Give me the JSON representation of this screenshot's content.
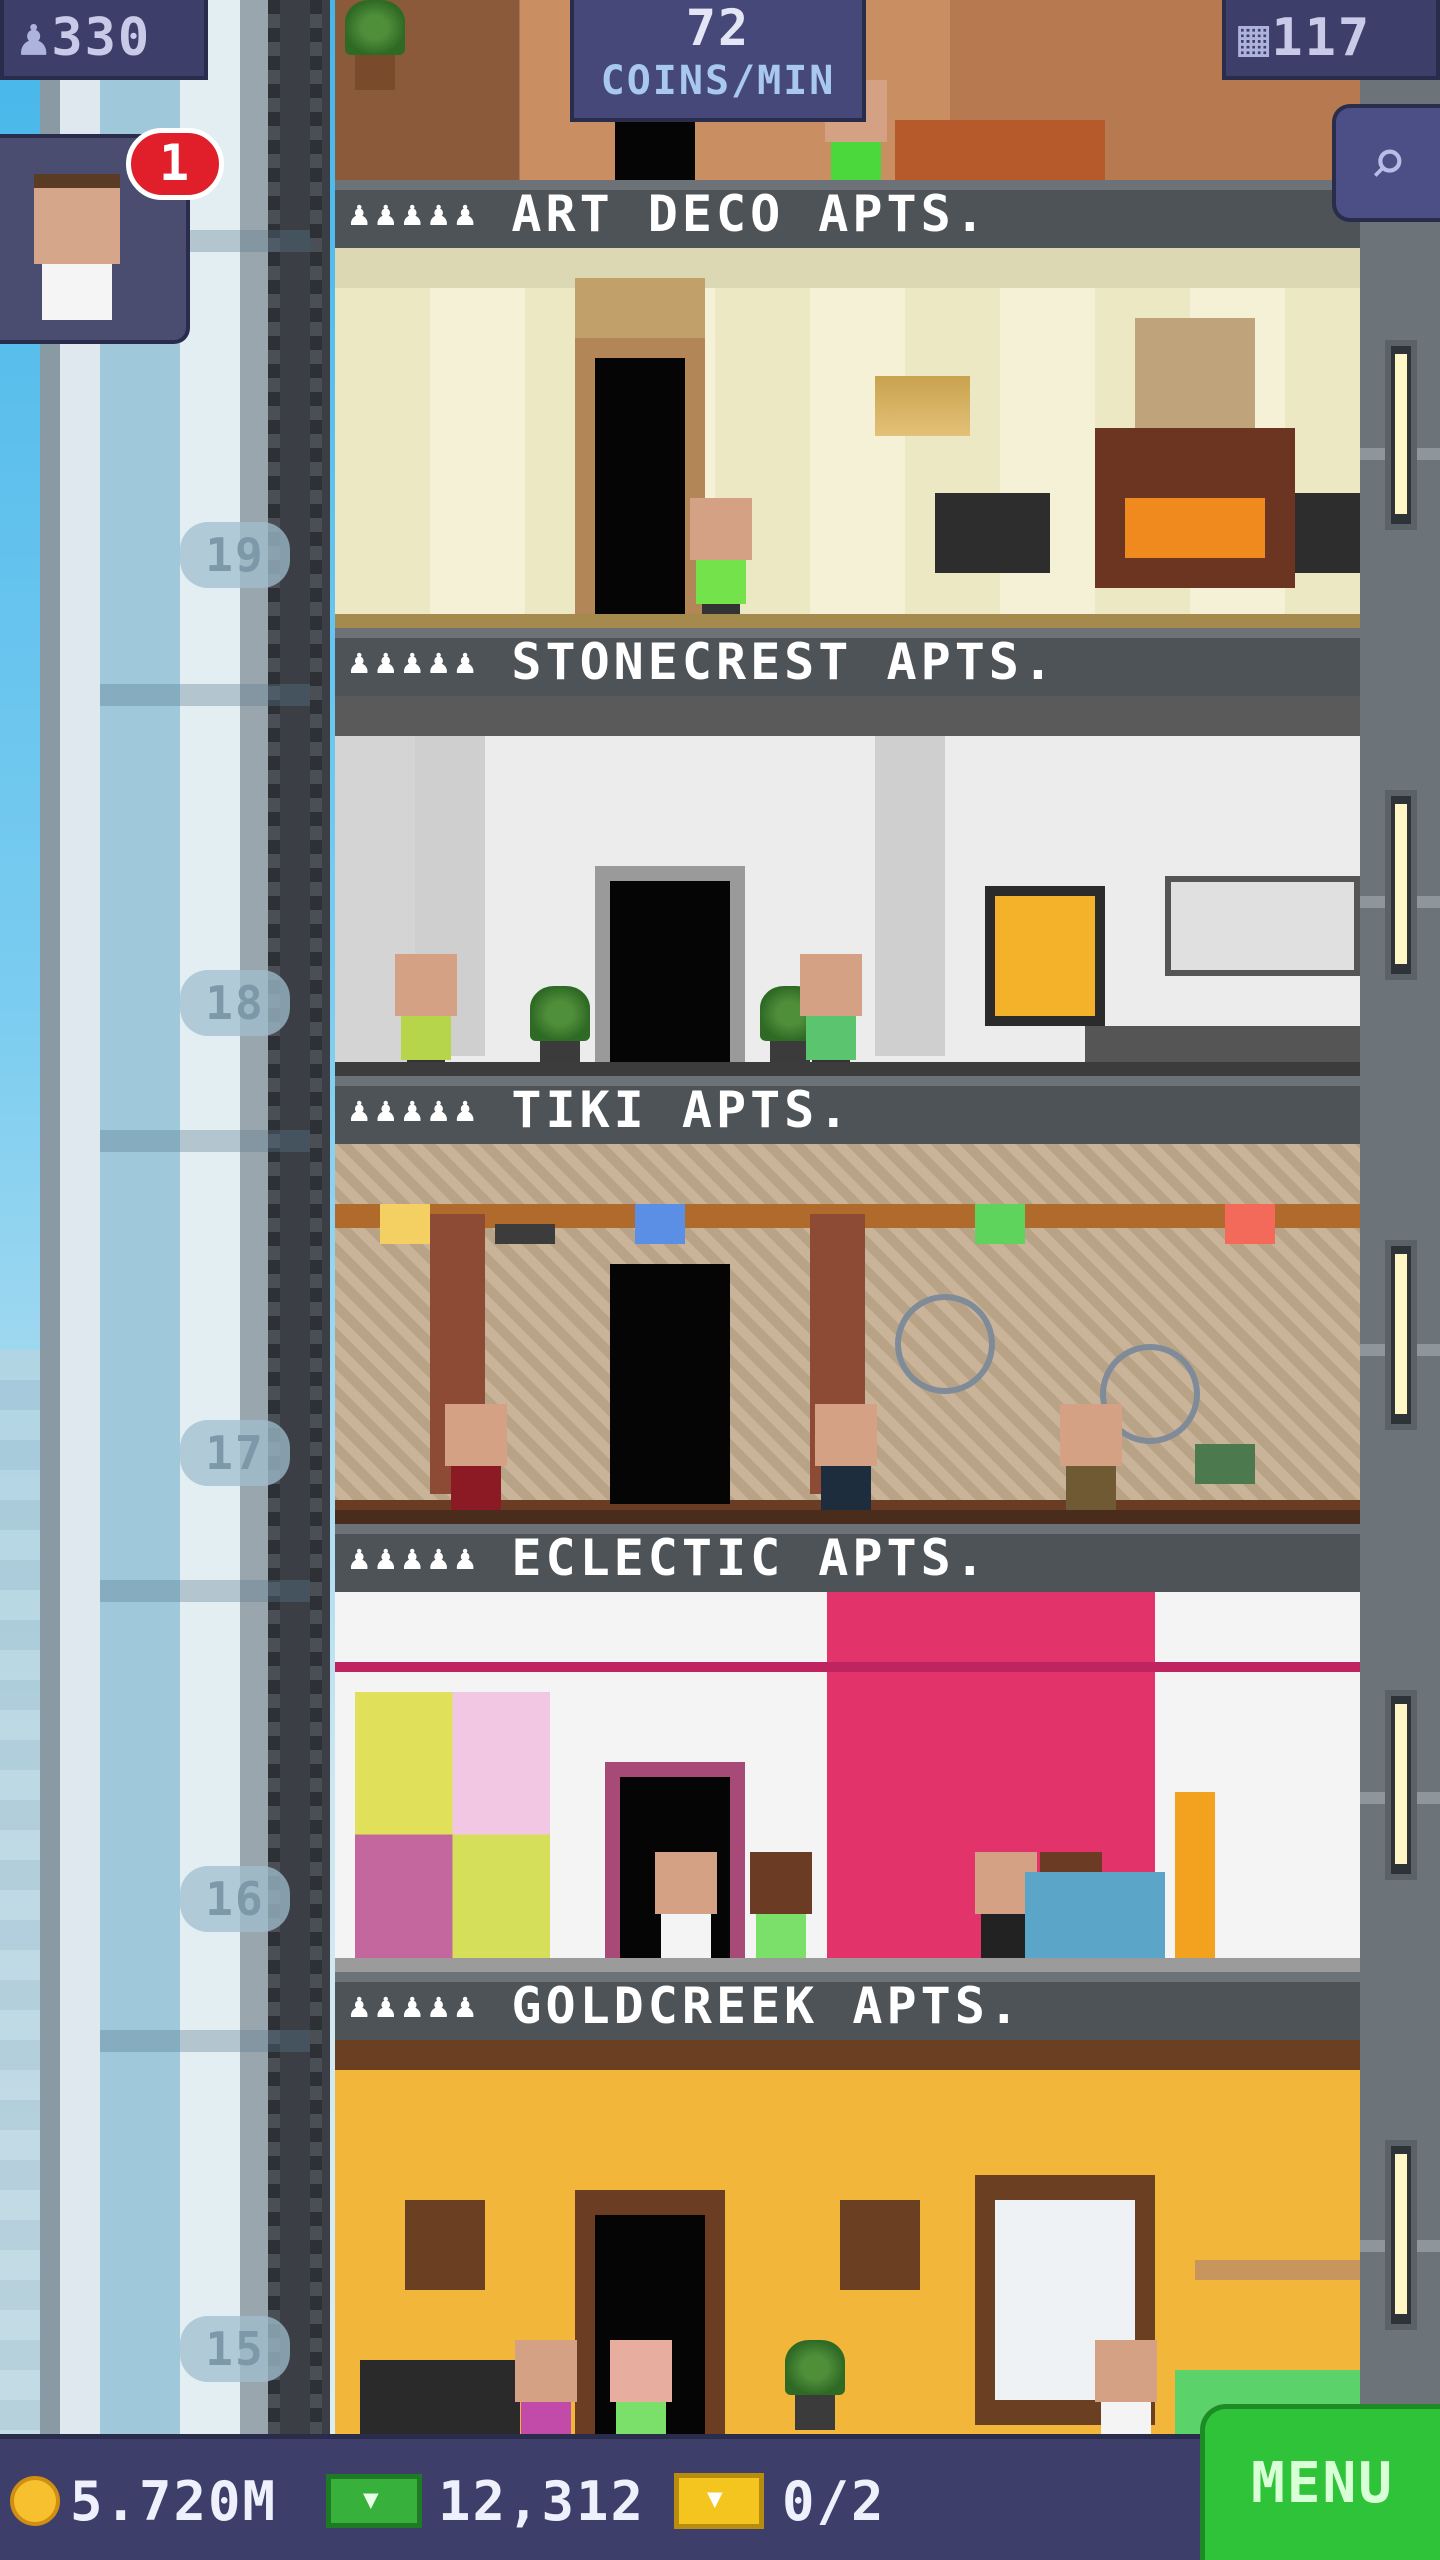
{
  "hud": {
    "population": "330",
    "coins_per_min_value": "72",
    "coins_per_min_unit": "COINS/MIN",
    "floor_count": "117",
    "notification_count": "1"
  },
  "floors": [
    {
      "name": "ART DECO APTS.",
      "number": ""
    },
    {
      "name": "STONECREST APTS.",
      "number": "19"
    },
    {
      "name": "TIKI APTS.",
      "number": "18"
    },
    {
      "name": "ECLECTIC APTS.",
      "number": "17"
    },
    {
      "name": "GOLDCREEK APTS.",
      "number": "16"
    },
    {
      "name": "",
      "number": "15"
    }
  ],
  "people_icons": "♟♟♟♟♟",
  "bottom": {
    "coins": "5.720M",
    "bux": "12,312",
    "tickets": "0/2",
    "menu_label": "MENU"
  },
  "icons": [
    "person-icon",
    "building-icon",
    "magnifier-icon",
    "coin-icon",
    "bux-icon",
    "ticket-icon"
  ]
}
